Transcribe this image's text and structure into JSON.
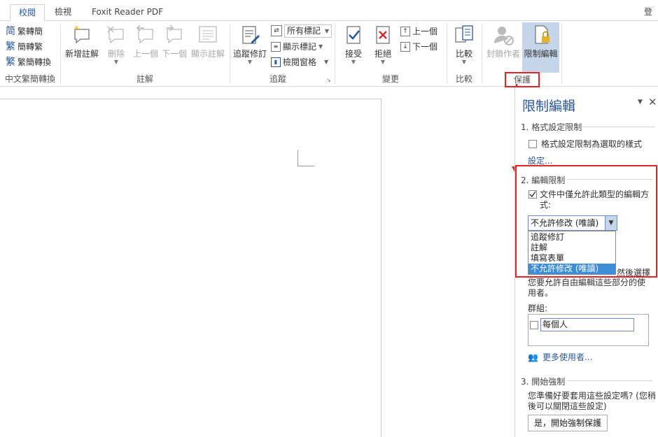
{
  "tabs": [
    "校閱",
    "檢視",
    "Foxit Reader PDF"
  ],
  "account_label": "登",
  "ribbon": {
    "chinese_group": {
      "items": [
        "繁轉簡",
        "簡轉繁",
        "繁簡轉換"
      ],
      "label": "中文繁簡轉換"
    },
    "comments_group": {
      "new_comment": "新增註解",
      "delete": "刪除",
      "previous": "上一個",
      "next": "下一個",
      "show_comments": "顯示註解",
      "label": "註解"
    },
    "tracking_group": {
      "track_changes": "追蹤修訂",
      "markup_select": "所有標記",
      "show_markup": "顯示標記",
      "review_pane": "檢閱窗格",
      "label": "追蹤"
    },
    "changes_group": {
      "accept": "接受",
      "reject": "拒絕",
      "previous": "上一個",
      "next": "下一個",
      "label": "變更"
    },
    "compare_group": {
      "compare": "比較",
      "label": "比較"
    },
    "protect_group": {
      "block_authors": "封鎖作者",
      "restrict_editing": "限制編輯",
      "label": "保護"
    }
  },
  "pane": {
    "title": "限制編輯",
    "section1": {
      "heading": "1. 格式設定限制",
      "checkbox_label": "格式設定限制為選取的樣式",
      "settings_link": "設定..."
    },
    "section2": {
      "heading": "2. 編輯限制",
      "checkbox_label_line1": "文件中僅允許此類型的編輯方",
      "checkbox_label_line2": "式:",
      "selected": "不允許修改 (唯讀)",
      "options": [
        "追蹤修訂",
        "註解",
        "填寫表單",
        "不允許修改 (唯讀)"
      ],
      "behind_text": "然後選擇",
      "exceptions_line1": "您要允許自由編輯這些部分的使",
      "exceptions_line2": "用者。",
      "groups_label": "群組:",
      "everyone": "每個人",
      "more_users": "更多使用者..."
    },
    "section3": {
      "heading": "3. 開始強制",
      "text_line1": "您準備好要套用這些設定嗎? (您稍",
      "text_line2": "後可以關閉這些設定)",
      "button": "是，開始強制保護"
    }
  },
  "colors": {
    "accent": "#2b579a",
    "annotation_red": "#e0242a",
    "selection": "#3c8ed8"
  }
}
